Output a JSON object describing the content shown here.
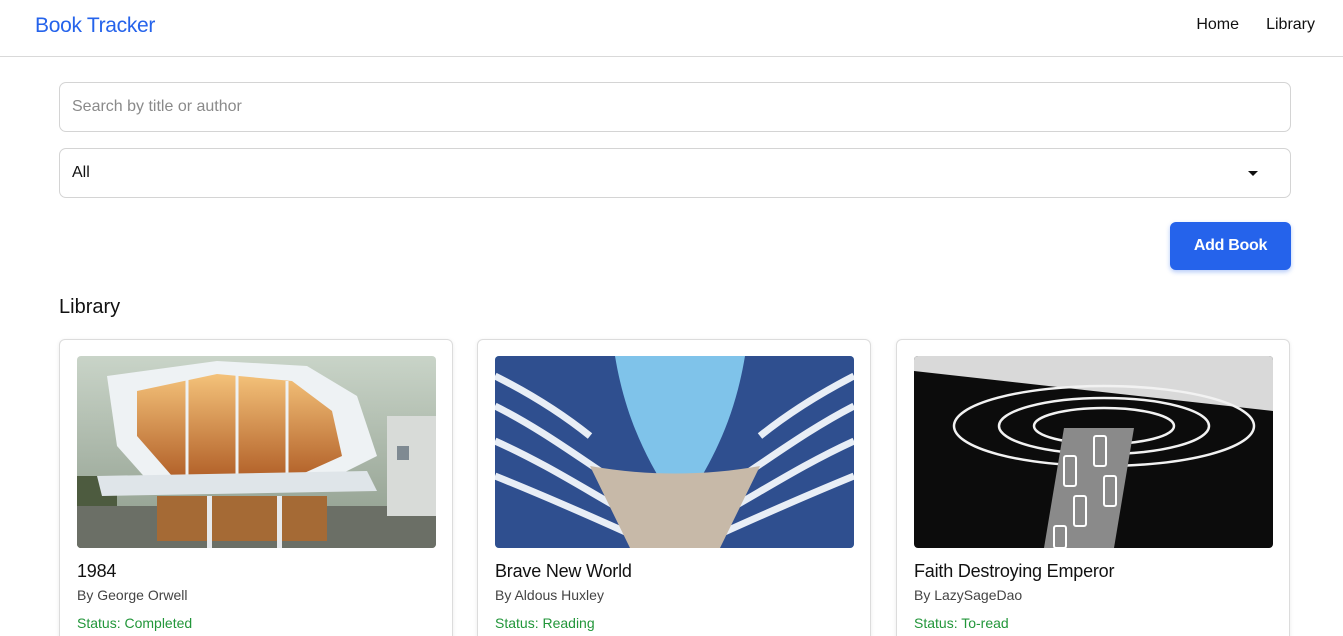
{
  "navbar": {
    "brand": "Book Tracker",
    "links": [
      {
        "label": "Home"
      },
      {
        "label": "Library"
      }
    ]
  },
  "search": {
    "placeholder": "Search by title or author",
    "value": ""
  },
  "filter": {
    "selected": "All"
  },
  "actions": {
    "add_book_label": "Add Book"
  },
  "section": {
    "title": "Library"
  },
  "books": [
    {
      "title": "1984",
      "author": "By George Orwell",
      "status": "Status: Completed"
    },
    {
      "title": "Brave New World",
      "author": "By Aldous Huxley",
      "status": "Status: Reading"
    },
    {
      "title": "Faith Destroying Emperor",
      "author": "By LazySageDao",
      "status": "Status: To-read"
    }
  ],
  "colors": {
    "brand": "#2563eb",
    "button": "#2563eb",
    "status": "#22963a",
    "border": "#d4d4d4"
  }
}
